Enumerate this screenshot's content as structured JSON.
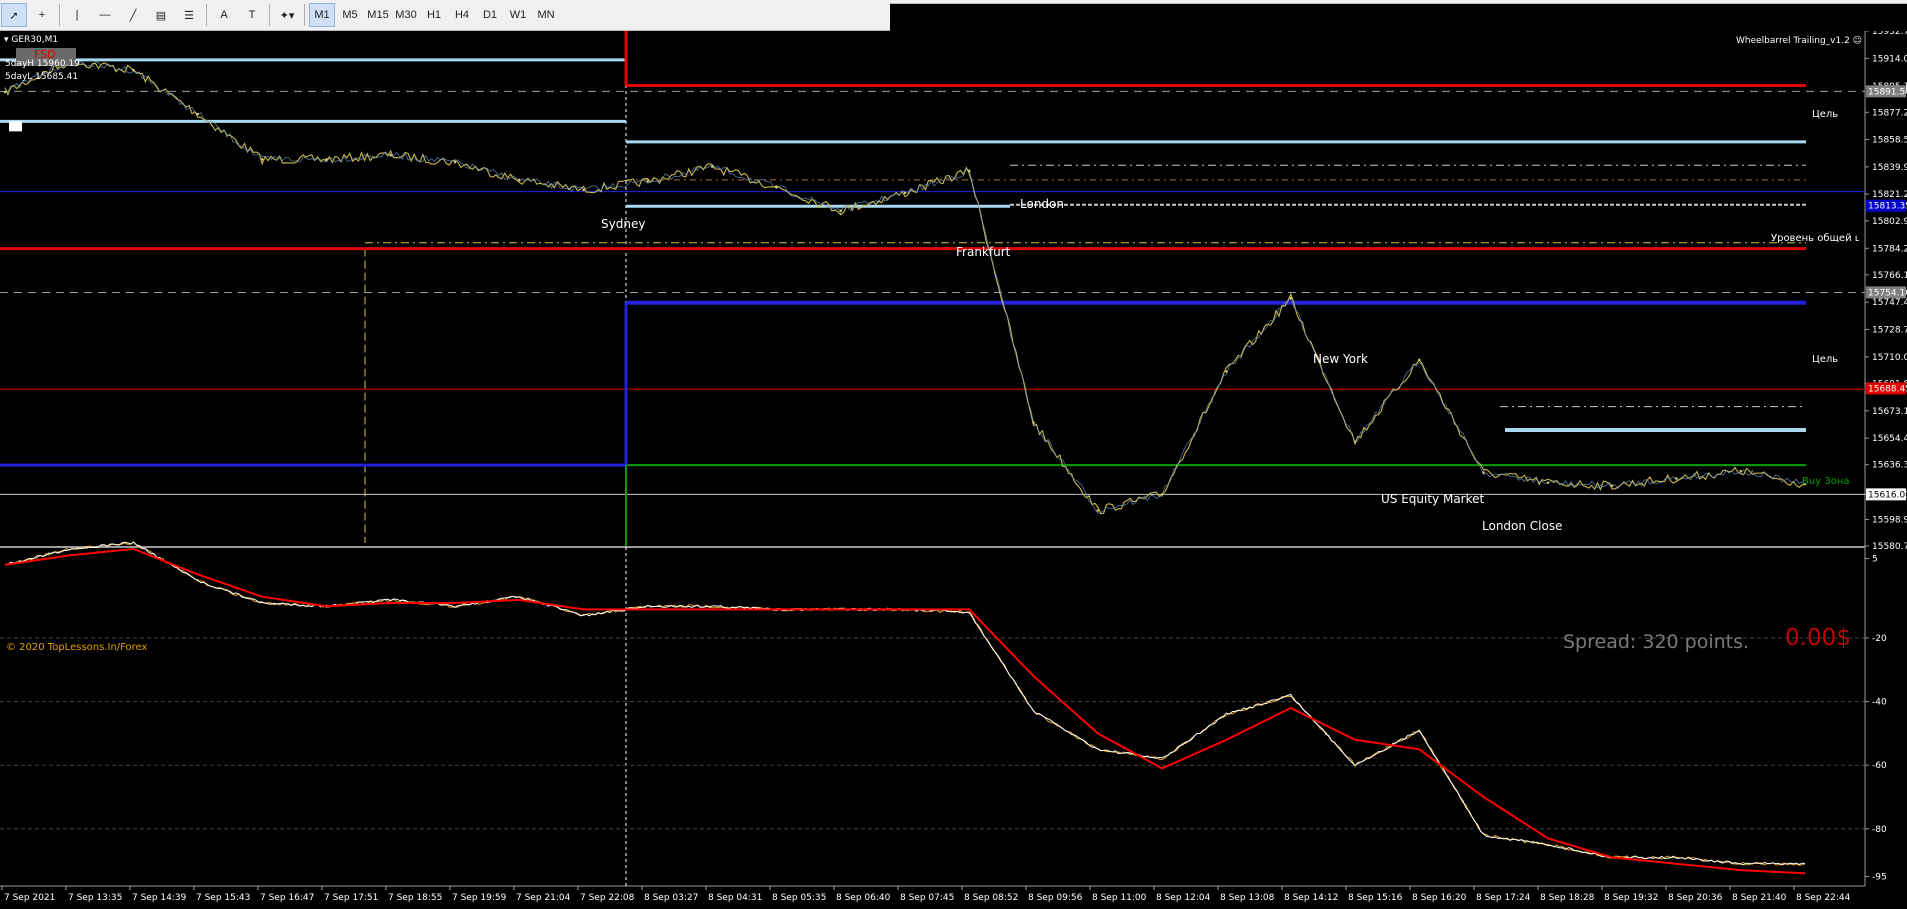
{
  "toolbar": {
    "tools": [
      {
        "name": "cursor-tool-button",
        "icon": "cursor-icon",
        "glyph": "➚"
      },
      {
        "name": "crosshair-tool-button",
        "icon": "crosshair-icon",
        "glyph": "+"
      },
      {
        "name": "vertical-line-tool-button",
        "icon": "vertical-line-icon",
        "glyph": "|"
      },
      {
        "name": "horizontal-line-tool-button",
        "icon": "horizontal-line-icon",
        "glyph": "—"
      },
      {
        "name": "trendline-tool-button",
        "icon": "trendline-icon",
        "glyph": "╱"
      },
      {
        "name": "fibonacci-tool-button",
        "icon": "fibonacci-icon",
        "glyph": "▤"
      },
      {
        "name": "channel-tool-button",
        "icon": "channel-icon",
        "glyph": "☰"
      },
      {
        "name": "text-tool-button",
        "icon": "text-icon",
        "glyph": "A"
      },
      {
        "name": "text-label-tool-button",
        "icon": "text-label-icon",
        "glyph": "T"
      },
      {
        "name": "shapes-menu-button",
        "icon": "shapes-icon",
        "glyph": "✦▾"
      }
    ],
    "timeframes": [
      "M1",
      "M5",
      "M15",
      "M30",
      "H1",
      "H4",
      "D1",
      "W1",
      "MN"
    ],
    "active_timeframe": "M1"
  },
  "chart_header": {
    "symbol": "GER30,M1",
    "expert": "Wheelbarrel Trailing_v1.2",
    "badge": "FSD"
  },
  "info_lines": [
    "5dayH 15960.19",
    "5dayL 15685.41"
  ],
  "copyright": "© 2020 TopLessons.In/Forex",
  "spread_text": "Spread: 320 points.",
  "profit_text": "0.00$",
  "session_labels": [
    {
      "text": "Sydney"
    },
    {
      "text": "London"
    },
    {
      "text": "Frankfurt"
    },
    {
      "text": "New York"
    },
    {
      "text": "US Equity Market"
    },
    {
      "text": "London Close"
    }
  ],
  "right_labels": [
    {
      "text": "Цель",
      "color": "#ffffff"
    },
    {
      "text": "Уровень общей ц",
      "color": "#ffffff"
    },
    {
      "text": "Цель",
      "color": "#ffffff"
    },
    {
      "text": "Buy Зона",
      "color": "#00a000"
    }
  ],
  "price_axis": {
    "ticks": [
      "15932.75",
      "15914.05",
      "15895.10",
      "15877.20",
      "15858.55",
      "15839.90",
      "15821.25",
      "15802.95",
      "15784.25",
      "15766.10",
      "15747.40",
      "15728.75",
      "15710.05",
      "15691.85",
      "15673.15",
      "15654.45",
      "15636.30",
      "15616.04",
      "15598.90",
      "15580.75"
    ],
    "badges": [
      {
        "price": "15891.50",
        "color": "#808080"
      },
      {
        "price": "15813.35",
        "color": "#0000cc"
      },
      {
        "price": "15754.10",
        "color": "#808080"
      },
      {
        "price": "15688.45",
        "color": "#e00000"
      },
      {
        "price": "15616.04",
        "color": "#ffffff"
      }
    ]
  },
  "indicator_axis": {
    "ticks": [
      "5",
      "-20",
      "-40",
      "-60",
      "-80",
      "-95"
    ]
  },
  "time_axis": {
    "labels": [
      "7 Sep 2021",
      "7 Sep 13:35",
      "7 Sep 14:39",
      "7 Sep 15:43",
      "7 Sep 16:47",
      "7 Sep 17:51",
      "7 Sep 18:55",
      "7 Sep 19:59",
      "7 Sep 21:04",
      "7 Sep 22:08",
      "8 Sep 03:27",
      "8 Sep 04:31",
      "8 Sep 05:35",
      "8 Sep 06:40",
      "8 Sep 07:45",
      "8 Sep 08:52",
      "8 Sep 09:56",
      "8 Sep 11:00",
      "8 Sep 12:04",
      "8 Sep 13:08",
      "8 Sep 14:12",
      "8 Sep 15:16",
      "8 Sep 16:20",
      "8 Sep 17:24",
      "8 Sep 18:28",
      "8 Sep 19:32",
      "8 Sep 20:36",
      "8 Sep 21:40",
      "8 Sep 22:44"
    ]
  },
  "chart_data": {
    "type": "line",
    "symbol": "GER30",
    "timeframe": "M1",
    "ylim": [
      15580.75,
      15932.75
    ],
    "x": [
      "7 Sep 2021",
      "7 Sep 13:35",
      "7 Sep 14:39",
      "7 Sep 15:43",
      "7 Sep 16:47",
      "7 Sep 17:51",
      "7 Sep 18:55",
      "7 Sep 19:59",
      "7 Sep 21:04",
      "7 Sep 22:08",
      "8 Sep 03:27",
      "8 Sep 04:31",
      "8 Sep 05:35",
      "8 Sep 06:40",
      "8 Sep 07:45",
      "8 Sep 08:52",
      "8 Sep 09:56",
      "8 Sep 11:00",
      "8 Sep 12:04",
      "8 Sep 13:08",
      "8 Sep 14:12",
      "8 Sep 15:16",
      "8 Sep 16:20",
      "8 Sep 17:24",
      "8 Sep 18:28",
      "8 Sep 19:32",
      "8 Sep 20:36",
      "8 Sep 21:40",
      "8 Sep 22:44"
    ],
    "series": [
      {
        "values": [
          15891,
          15912,
          15906,
          15876,
          15845,
          15845,
          15848,
          15843,
          15831,
          15824,
          15830,
          15840,
          15826,
          15810,
          15822,
          15837,
          15665,
          15605,
          15616,
          15700,
          15750,
          15652,
          15708,
          15631,
          15624,
          15622,
          15627,
          15632,
          15623
        ]
      }
    ],
    "levels": [
      15913,
      15895.5,
      15891.5,
      15871,
      15857,
      15841,
      15831,
      15823,
      15814,
      15813,
      15809,
      15788,
      15784,
      15754,
      15747,
      15688,
      15676,
      15660,
      15636,
      15616
    ],
    "indicator": {
      "ylim": [
        -98,
        8
      ],
      "ticks": [
        5,
        -20,
        -40,
        -60,
        -80,
        -95
      ],
      "series": [
        {
          "color": "#ffffff",
          "values": [
            3,
            8,
            10,
            -2,
            -9,
            -10,
            -8,
            -10,
            -7,
            -13,
            -10,
            -10,
            -11,
            -11,
            -11,
            -12,
            -43,
            -55,
            -58,
            -44,
            -38,
            -60,
            -49,
            -82,
            -85,
            -89,
            -89,
            -91,
            -91
          ]
        },
        {
          "color": "#ff0000",
          "values": [
            3,
            6,
            8,
            0,
            -7,
            -10,
            -9,
            -9,
            -8,
            -11,
            -11,
            -11,
            -11,
            -11,
            -11,
            -11,
            -32,
            -50,
            -61,
            -52,
            -42,
            -52,
            -55,
            -70,
            -83,
            -89,
            -91,
            -93,
            -94
          ]
        }
      ]
    }
  }
}
